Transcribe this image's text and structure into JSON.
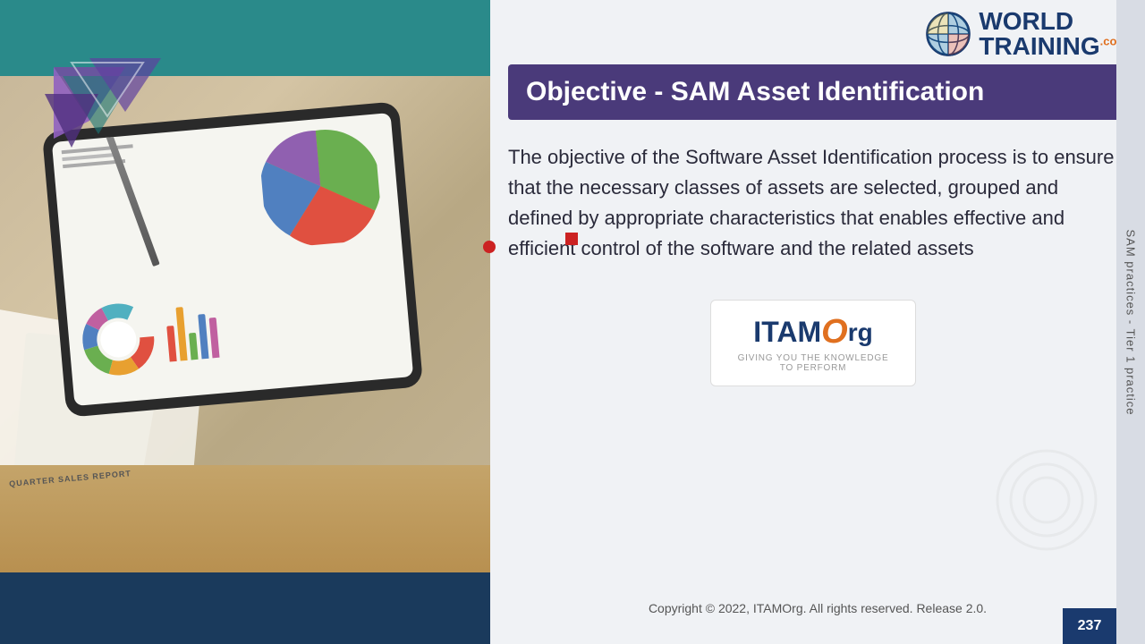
{
  "page": {
    "slide_number": "237",
    "sidebar_text": "SAM practices - Tier 1 practice"
  },
  "header": {
    "logo": {
      "world_text": "WORLD",
      "training_text": "TRAINING",
      "dot_com": ".com"
    }
  },
  "title": {
    "text": "Objective - SAM Asset Identification"
  },
  "body": {
    "paragraph": "The objective of the Software Asset Identification process is to ensure that the necessary classes of assets are selected, grouped and defined by appropriate characteristics that enables effective and efficient control of the software and the related assets"
  },
  "itam_logo": {
    "main": "ITAM",
    "o": "O",
    "rg": "rg",
    "tagline_line1": "GIVING YOU THE KNOWLEDGE",
    "tagline_line2": "TO PERFORM"
  },
  "footer": {
    "copyright": "Copyright © 2022, ITAMOrg. All rights reserved. Release 2.0."
  },
  "chart": {
    "pie_colors": [
      "#6aaf50",
      "#e8a030",
      "#e05040",
      "#5080c0",
      "#9060b0"
    ],
    "donut_colors": [
      "#e05040",
      "#e8a030",
      "#6aaf50",
      "#5080c0",
      "#c060a0",
      "#50b0c0"
    ],
    "bar_colors": [
      "#e05040",
      "#e8a030",
      "#6aaf50",
      "#5080c0",
      "#c060a0"
    ],
    "bar_heights": [
      40,
      60,
      30,
      50,
      45
    ]
  },
  "yellow_accent_bars": {
    "colors": [
      "#f0b830",
      "#d09020"
    ],
    "heights": [
      60,
      90
    ]
  }
}
